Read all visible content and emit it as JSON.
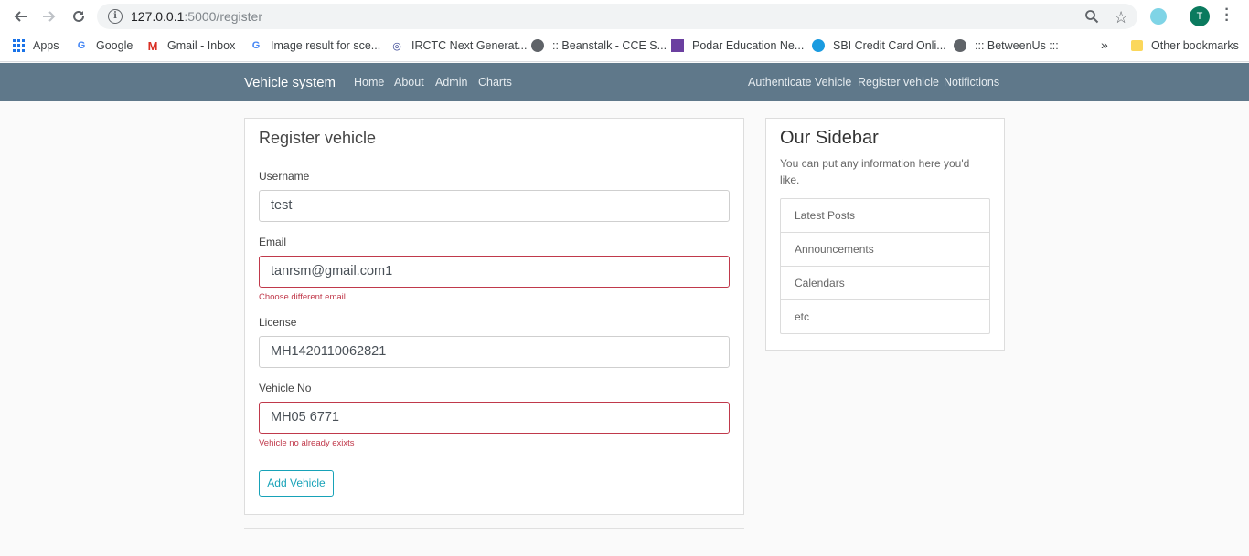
{
  "browser": {
    "url_host": "127.0.0.1",
    "url_path": ":5000/register",
    "profile_initial": "T",
    "bookmarks": [
      {
        "label": "Apps"
      },
      {
        "label": "Google"
      },
      {
        "label": "Gmail - Inbox"
      },
      {
        "label": "Image result for sce..."
      },
      {
        "label": "IRCTC Next Generat..."
      },
      {
        "label": ":: Beanstalk - CCE S..."
      },
      {
        "label": "Podar Education Ne..."
      },
      {
        "label": "SBI Credit Card Onli..."
      },
      {
        "label": "::: BetweenUs :::"
      }
    ],
    "overflow": "»",
    "other_bookmarks": "Other bookmarks"
  },
  "navbar": {
    "brand": "Vehicle system",
    "left_links": [
      "Home",
      "About",
      "Admin",
      "Charts"
    ],
    "right_links": [
      "Authenticate Vehicle",
      "Register vehicle",
      "Notifictions"
    ]
  },
  "form": {
    "legend": "Register vehicle",
    "username": {
      "label": "Username",
      "value": "test"
    },
    "email": {
      "label": "Email",
      "value": "tanrsm@gmail.com1",
      "error": "Choose different email"
    },
    "license": {
      "label": "License",
      "value": "MH1420110062821"
    },
    "vehicle_no": {
      "label": "Vehicle No",
      "value": "MH05 6771",
      "error": "Vehicle no already exixts"
    },
    "submit_label": "Add Vehicle"
  },
  "sidebar": {
    "title": "Our Sidebar",
    "description": "You can put any information here you'd like.",
    "items": [
      "Latest Posts",
      "Announcements",
      "Calendars",
      "etc"
    ]
  },
  "colors": {
    "navbar": "#5f788a",
    "error": "#c0394b",
    "accent": "#17a2b8"
  }
}
